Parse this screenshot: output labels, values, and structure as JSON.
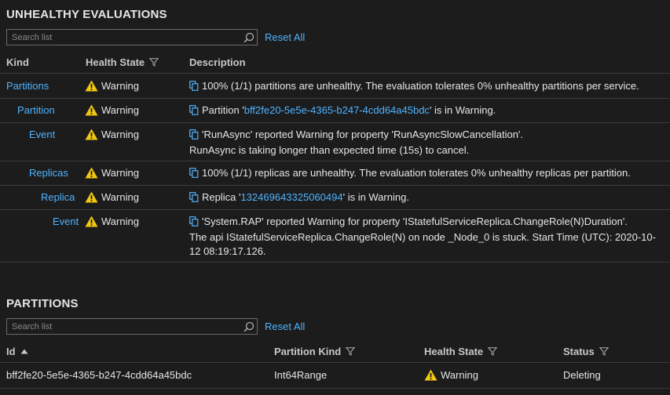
{
  "unhealthy": {
    "title": "UNHEALTHY EVALUATIONS",
    "search_placeholder": "Search list",
    "reset_label": "Reset All",
    "headers": {
      "kind": "Kind",
      "health_state": "Health State",
      "description": "Description"
    },
    "rows": [
      {
        "kind": "Partitions",
        "health": "Warning",
        "desc": "100% (1/1) partitions are unhealthy. The evaluation tolerates 0% unhealthy partitions per service."
      },
      {
        "kind": "Partition",
        "health": "Warning",
        "desc_pre": "Partition '",
        "desc_link": "bff2fe20-5e5e-4365-b247-4cdd64a45bdc",
        "desc_post": "' is in Warning."
      },
      {
        "kind": "Event",
        "health": "Warning",
        "desc_line1": "'RunAsync' reported Warning for property 'RunAsyncSlowCancellation'.",
        "desc_line2": "RunAsync is taking longer than expected time (15s) to cancel."
      },
      {
        "kind": "Replicas",
        "health": "Warning",
        "desc": "100% (1/1) replicas are unhealthy. The evaluation tolerates 0% unhealthy replicas per partition."
      },
      {
        "kind": "Replica",
        "health": "Warning",
        "desc_pre": "Replica '",
        "desc_link": "132469643325060494",
        "desc_post": "' is in Warning."
      },
      {
        "kind": "Event",
        "health": "Warning",
        "desc_line1": "'System.RAP' reported Warning for property 'IStatefulServiceReplica.ChangeRole(N)Duration'.",
        "desc_line2": "The api IStatefulServiceReplica.ChangeRole(N) on node _Node_0 is stuck. Start Time (UTC): 2020-10-",
        "desc_line3": "12 08:19:17.126."
      }
    ]
  },
  "partitions": {
    "title": "PARTITIONS",
    "search_placeholder": "Search list",
    "reset_label": "Reset All",
    "headers": {
      "id": "Id",
      "kind": "Partition Kind",
      "health_state": "Health State",
      "status": "Status"
    },
    "rows": [
      {
        "id": "bff2fe20-5e5e-4365-b247-4cdd64a45bdc",
        "kind": "Int64Range",
        "health": "Warning",
        "status": "Deleting"
      }
    ]
  },
  "colors": {
    "background": "#1c1c1c",
    "link": "#4fb3ff",
    "warning": "#f2c811",
    "border": "#3c3c3c"
  },
  "icons": {
    "search": "search-icon",
    "filter": "filter-icon",
    "warning": "warning-icon",
    "copy": "copy-icon",
    "sort": "sort-ascending-icon"
  }
}
